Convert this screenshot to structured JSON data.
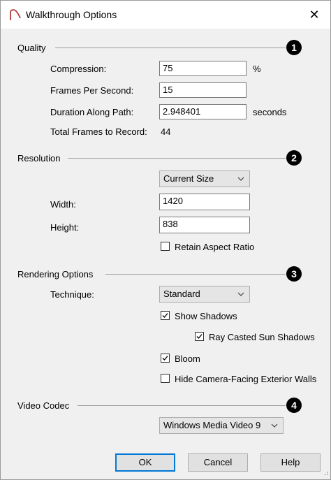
{
  "window": {
    "title": "Walkthrough Options",
    "close_glyph": "✕"
  },
  "quality": {
    "section_title": "Quality",
    "badge": "1",
    "compression_label": "Compression:",
    "compression_value": "75",
    "compression_unit": "%",
    "fps_label": "Frames Per Second:",
    "fps_value": "15",
    "duration_label": "Duration Along Path:",
    "duration_value": "2.948401",
    "duration_unit": "seconds",
    "total_frames_label": "Total Frames to Record:",
    "total_frames_value": "44"
  },
  "resolution": {
    "section_title": "Resolution",
    "badge": "2",
    "size_selected": "Current Size",
    "width_label": "Width:",
    "width_value": "1420",
    "height_label": "Height:",
    "height_value": "838",
    "retain_aspect_label": "Retain Aspect Ratio",
    "retain_aspect_checked": false
  },
  "rendering": {
    "section_title": "Rendering Options",
    "badge": "3",
    "technique_label": "Technique:",
    "technique_selected": "Standard",
    "show_shadows_label": "Show Shadows",
    "show_shadows_checked": true,
    "ray_casted_label": "Ray Casted Sun Shadows",
    "ray_casted_checked": true,
    "bloom_label": "Bloom",
    "bloom_checked": true,
    "hide_walls_label": "Hide Camera-Facing Exterior Walls",
    "hide_walls_checked": false
  },
  "codec": {
    "section_title": "Video Codec",
    "badge": "4",
    "codec_selected": "Windows Media Video 9"
  },
  "buttons": {
    "ok": "OK",
    "cancel": "Cancel",
    "help": "Help"
  },
  "icons": {
    "app": "chief-architect-arc-icon",
    "close": "close-icon",
    "dropdown": "chevron-down-icon",
    "check": "check-icon"
  }
}
